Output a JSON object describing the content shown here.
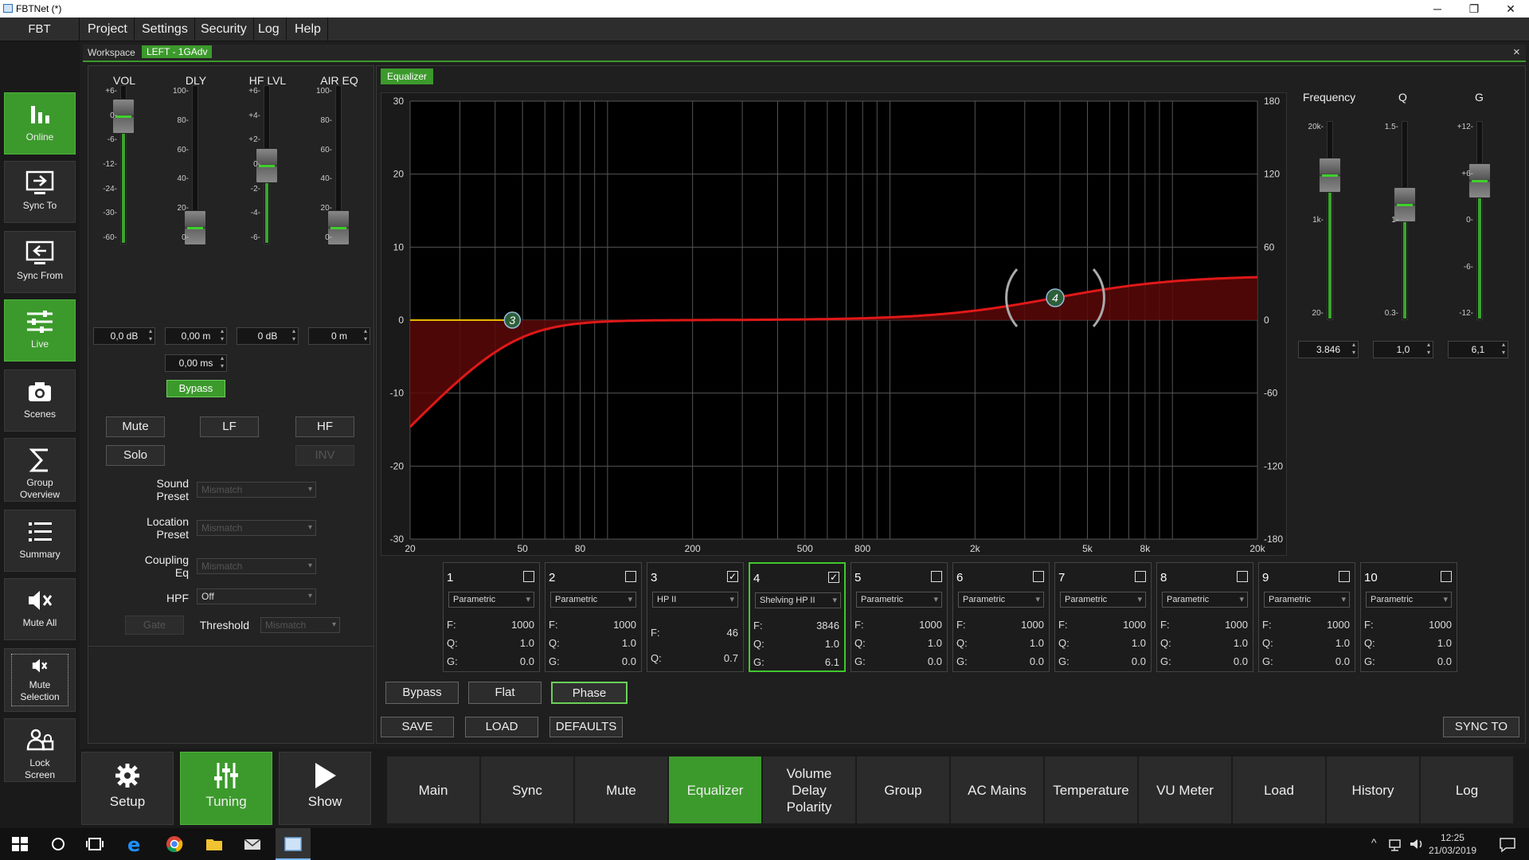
{
  "window": {
    "title": "FBTNet (*)",
    "minimize": "─",
    "restore": "❐",
    "close": "✕"
  },
  "menu": {
    "brand": "FBT",
    "items": [
      "Project",
      "Settings",
      "Security",
      "Log",
      "Help"
    ]
  },
  "sidebar": [
    {
      "label": "Online",
      "icon": "bar-chart-icon",
      "active": true
    },
    {
      "label": "Sync To",
      "icon": "monitor-arrow-icon",
      "active": false
    },
    {
      "label": "Sync From",
      "icon": "monitor-back-icon",
      "active": false
    },
    {
      "label": "Live",
      "icon": "sliders-icon",
      "active": true
    },
    {
      "label": "Scenes",
      "icon": "camera-icon",
      "active": false
    },
    {
      "label": "Group\nOverview",
      "icon": "sigma-icon",
      "active": false
    },
    {
      "label": "Summary",
      "icon": "list-icon",
      "active": false
    },
    {
      "label": "Mute All",
      "icon": "mute-speaker-icon",
      "active": false
    },
    {
      "label": "Mute\nSelection",
      "icon": "mute-selection-icon",
      "active": false
    },
    {
      "label": "Lock\nScreen",
      "icon": "lock-users-icon",
      "active": false
    }
  ],
  "workspace": {
    "label": "Workspace",
    "tab": "LEFT - 1GAdv",
    "close": "×"
  },
  "channel": {
    "faders": [
      {
        "label": "VOL",
        "ticks": [
          "+6",
          "0",
          "-6",
          "-12",
          "-24",
          "-30",
          "-60"
        ],
        "value": "0,0 dB",
        "level": 0.9
      },
      {
        "label": "DLY",
        "ticks": [
          "100",
          "80",
          "60",
          "40",
          "20",
          "0"
        ],
        "value": "0,00 m",
        "level": 0.0
      },
      {
        "label": "HF LVL",
        "ticks": [
          "+6",
          "+4",
          "+2",
          "0",
          "-2",
          "-4",
          "-6"
        ],
        "value": "0 dB",
        "level": 0.5
      },
      {
        "label": "AIR EQ",
        "ticks": [
          "100",
          "80",
          "60",
          "40",
          "20",
          "0"
        ],
        "value": "0 m",
        "level": 0.0
      }
    ],
    "delay_ms": "0,00 ms",
    "bypass": "Bypass",
    "mute": "Mute",
    "lf": "LF",
    "hf": "HF",
    "solo": "Solo",
    "inv": "INV",
    "sound_preset_label": "Sound\nPreset",
    "sound_preset": "Mismatch",
    "location_preset_label": "Location\nPreset",
    "location_preset": "Mismatch",
    "coupling_label": "Coupling\nEq",
    "coupling": "Mismatch",
    "hpf_label": "HPF",
    "hpf": "Off",
    "gate": "Gate",
    "threshold_label": "Threshold",
    "threshold": "Mismatch"
  },
  "eq": {
    "tab": "Equalizer",
    "y_left": [
      "30",
      "20",
      "10",
      "0",
      "-10",
      "-20",
      "-30"
    ],
    "y_right": [
      "180",
      "120",
      "60",
      "0",
      "-60",
      "-120",
      "-180"
    ],
    "x_labels": [
      "20",
      "50",
      "80",
      "200",
      "500",
      "800",
      "2k",
      "5k",
      "8k",
      "20k"
    ],
    "markers": [
      "3",
      "4"
    ],
    "bands": [
      {
        "n": "1",
        "type": "Parametric",
        "F": "1000",
        "Q": "1.0",
        "G": "0.0",
        "checked": false
      },
      {
        "n": "2",
        "type": "Parametric",
        "F": "1000",
        "Q": "1.0",
        "G": "0.0",
        "checked": false
      },
      {
        "n": "3",
        "type": "HP II",
        "F": "46",
        "Q": "0.7",
        "G": "",
        "checked": true
      },
      {
        "n": "4",
        "type": "Shelving HP II",
        "F": "3846",
        "Q": "1.0",
        "G": "6.1",
        "checked": true
      },
      {
        "n": "5",
        "type": "Parametric",
        "F": "1000",
        "Q": "1.0",
        "G": "0.0",
        "checked": false
      },
      {
        "n": "6",
        "type": "Parametric",
        "F": "1000",
        "Q": "1.0",
        "G": "0.0",
        "checked": false
      },
      {
        "n": "7",
        "type": "Parametric",
        "F": "1000",
        "Q": "1.0",
        "G": "0.0",
        "checked": false
      },
      {
        "n": "8",
        "type": "Parametric",
        "F": "1000",
        "Q": "1.0",
        "G": "0.0",
        "checked": false
      },
      {
        "n": "9",
        "type": "Parametric",
        "F": "1000",
        "Q": "1.0",
        "G": "0.0",
        "checked": false
      },
      {
        "n": "10",
        "type": "Parametric",
        "F": "1000",
        "Q": "1.0",
        "G": "0.0",
        "checked": false
      }
    ],
    "labels": {
      "F": "F:",
      "Q": "Q:",
      "G": "G:"
    },
    "bypass": "Bypass",
    "flat": "Flat",
    "phase": "Phase",
    "save": "SAVE",
    "load": "LOAD",
    "defaults": "DEFAULTS",
    "sync_to": "SYNC TO",
    "right": {
      "freq_label": "Frequency",
      "q_label": "Q",
      "g_label": "G",
      "freq_ticks": [
        "20k",
        "1k",
        "20"
      ],
      "q_ticks": [
        "1.5",
        "1",
        "0.3"
      ],
      "g_ticks": [
        "+12",
        "+6",
        "0",
        "-6",
        "-12"
      ],
      "freq_value": "3.846",
      "q_value": "1,0",
      "g_value": "6,1"
    }
  },
  "bottom": {
    "big": [
      {
        "label": "Setup",
        "icon": "gear-icon"
      },
      {
        "label": "Tuning",
        "icon": "tuning-sliders-icon"
      },
      {
        "label": "Show",
        "icon": "play-icon"
      }
    ],
    "tabs": [
      "Main",
      "Sync",
      "Mute",
      "Equalizer",
      "Volume\nDelay\nPolarity",
      "Group",
      "AC Mains",
      "Temperature",
      "VU Meter",
      "Load",
      "History",
      "Log"
    ]
  },
  "taskbar": {
    "time": "12:25",
    "date": "21/03/2019"
  },
  "colors": {
    "accent": "#3c9a2c",
    "curve": "#e01818",
    "fill": "#5a0808",
    "flatline": "#e6b800"
  }
}
